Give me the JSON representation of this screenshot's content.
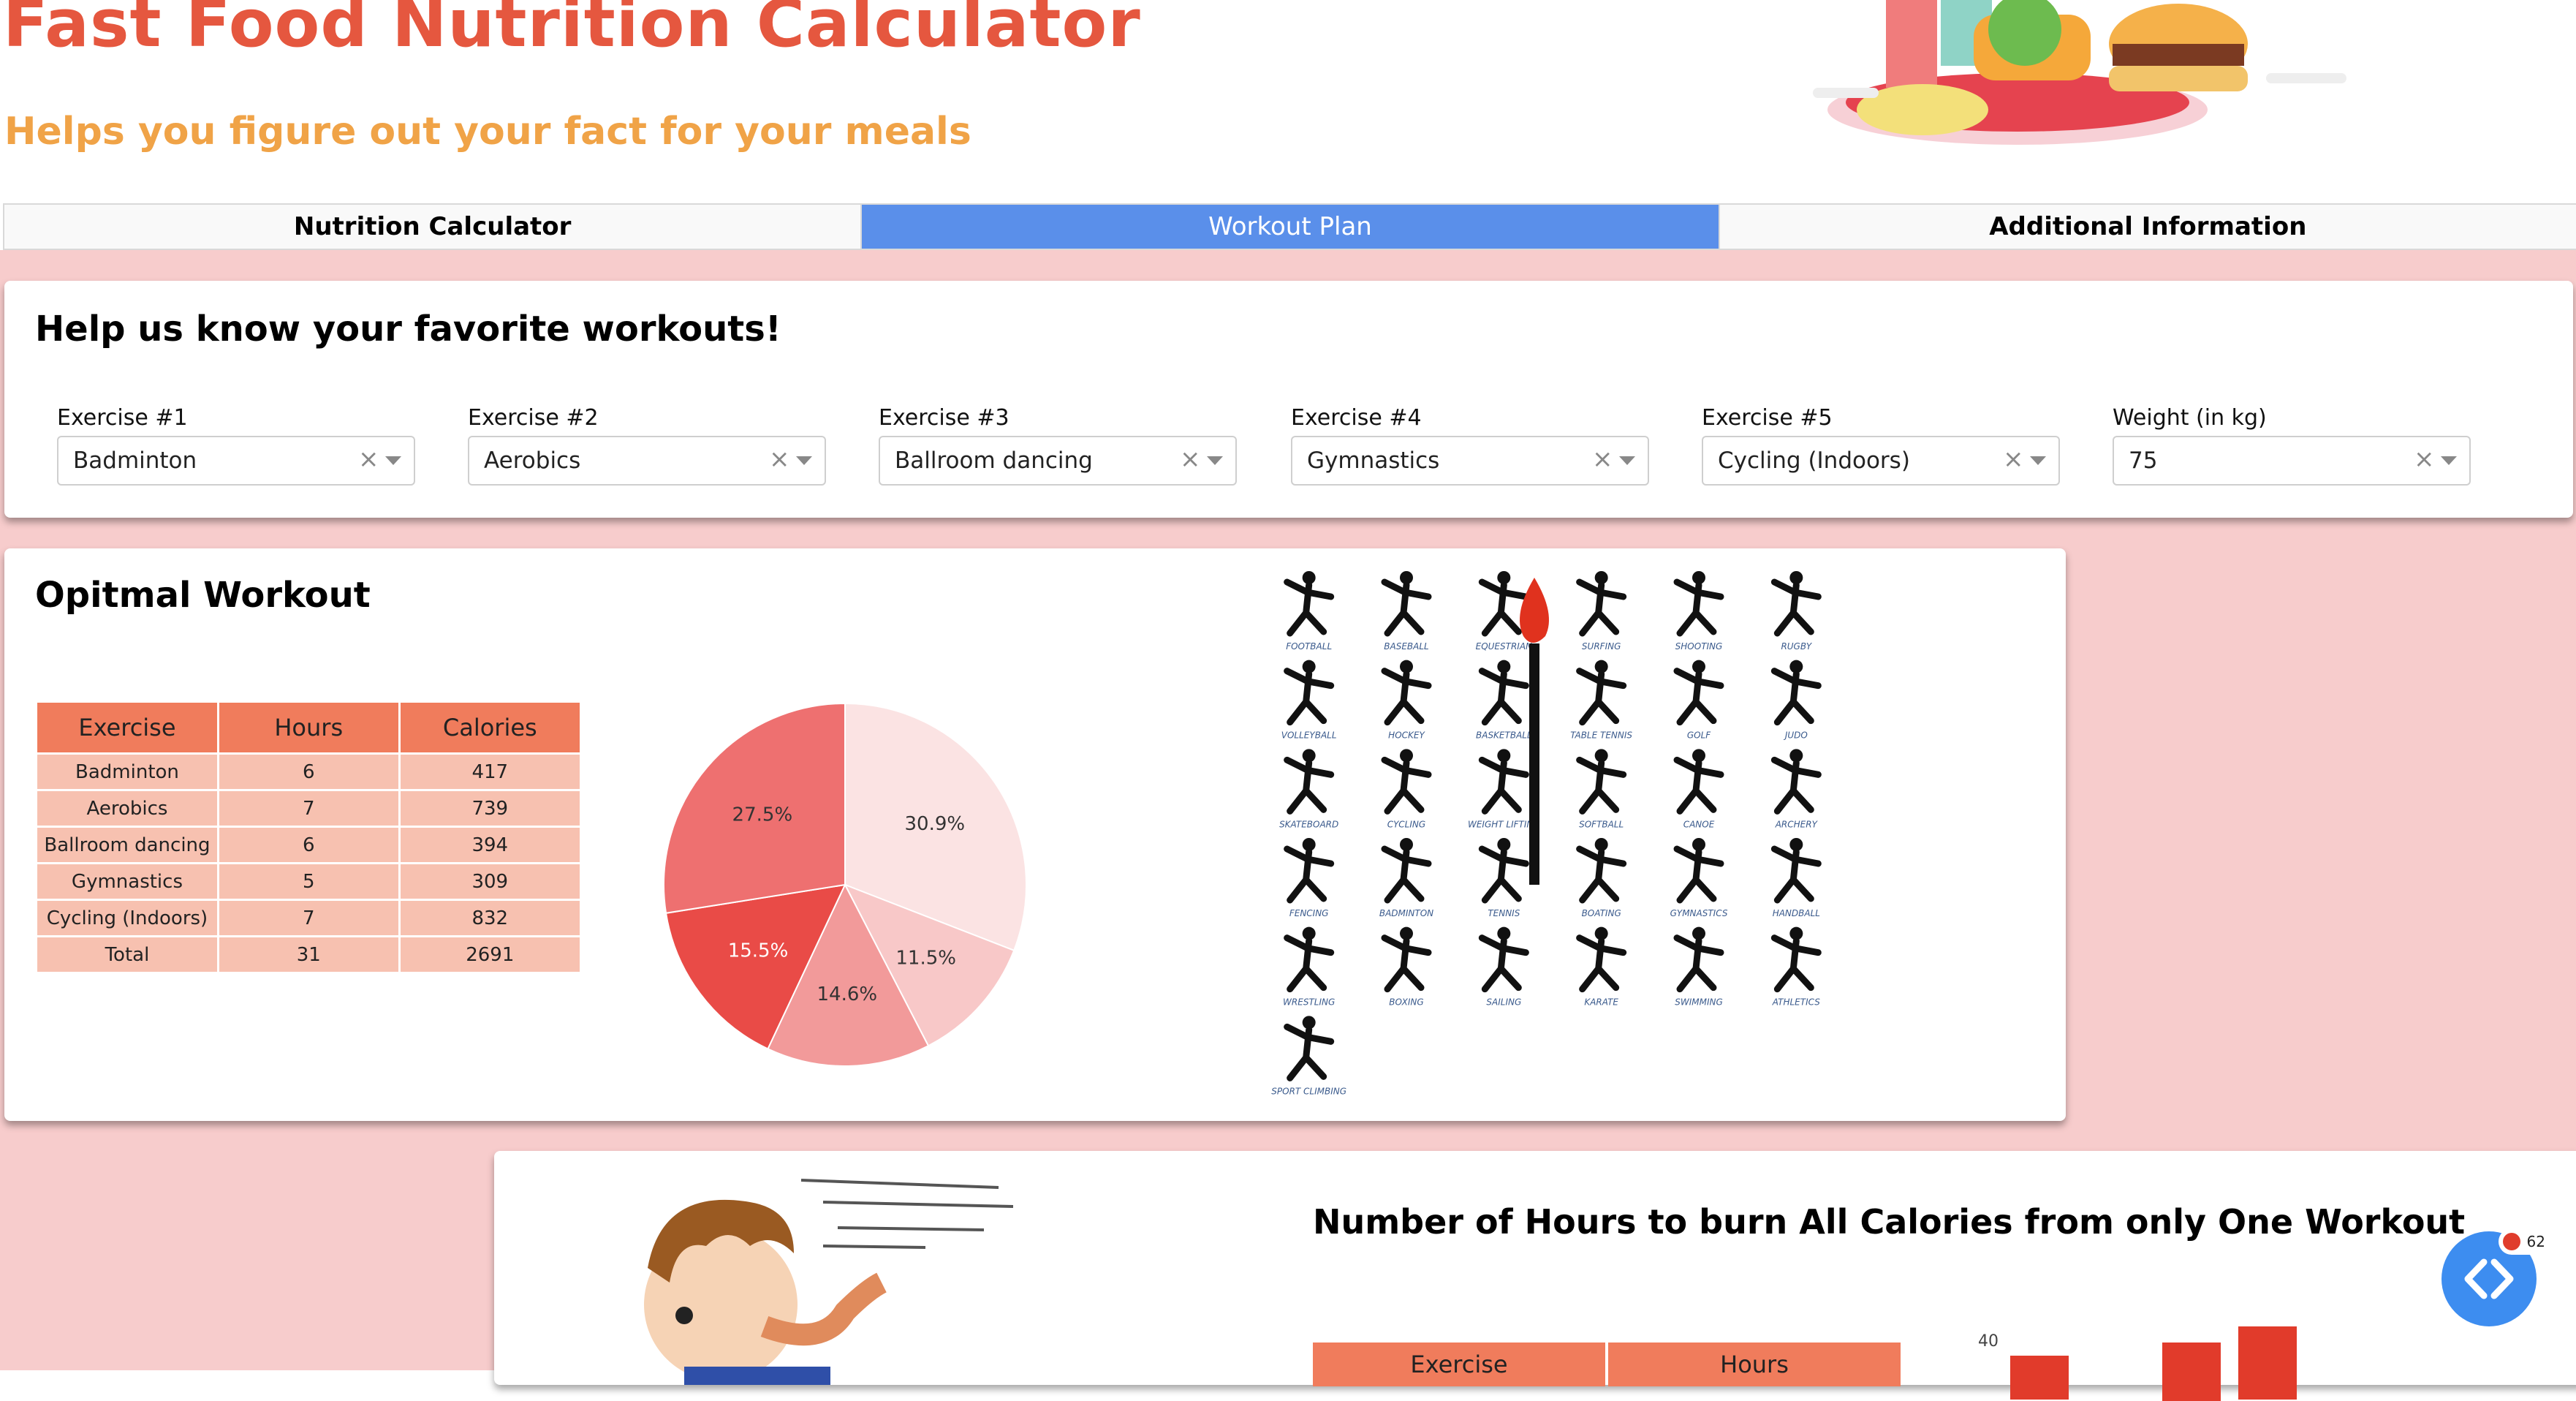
{
  "header": {
    "title": "Fast Food Nutrition Calculator",
    "subtitle": "Helps you figure out your fact for your meals"
  },
  "tabs": [
    {
      "label": "Nutrition Calculator",
      "active": false
    },
    {
      "label": "Workout Plan",
      "active": true
    },
    {
      "label": "Additional Information",
      "active": false
    }
  ],
  "workouts": {
    "title": "Help us know your favorite workouts!",
    "dropdowns": [
      {
        "label": "Exercise #1",
        "value": "Badminton"
      },
      {
        "label": "Exercise #2",
        "value": "Aerobics"
      },
      {
        "label": "Exercise #3",
        "value": "Ballroom dancing"
      },
      {
        "label": "Exercise #4",
        "value": "Gymnastics"
      },
      {
        "label": "Exercise #5",
        "value": "Cycling (Indoors)"
      },
      {
        "label": "Weight (in kg)",
        "value": "75"
      }
    ],
    "clear_glyph": "×"
  },
  "optimal": {
    "title": "Opitmal Workout",
    "table": {
      "headers": [
        "Exercise",
        "Hours",
        "Calories"
      ],
      "rows": [
        [
          "Badminton",
          "6",
          "417"
        ],
        [
          "Aerobics",
          "7",
          "739"
        ],
        [
          "Ballroom dancing",
          "6",
          "394"
        ],
        [
          "Gymnastics",
          "5",
          "309"
        ],
        [
          "Cycling (Indoors)",
          "7",
          "832"
        ],
        [
          "Total",
          "31",
          "2691"
        ]
      ]
    },
    "pie": {
      "slices": [
        {
          "label": "30.9%",
          "value": 30.9,
          "color": "#fbe3e3"
        },
        {
          "label": "11.5%",
          "value": 11.5,
          "color": "#f8c8c8"
        },
        {
          "label": "14.6%",
          "value": 14.6,
          "color": "#f29a9a"
        },
        {
          "label": "15.5%",
          "value": 15.5,
          "color": "#e94b47"
        },
        {
          "label": "27.5%",
          "value": 27.5,
          "color": "#ee7070"
        }
      ]
    },
    "sports_labels": [
      "FOOTBALL",
      "BASEBALL",
      "EQUESTRIAN",
      "SURFING",
      "SHOOTING",
      "RUGBY",
      "VOLLEYBALL",
      "HOCKEY",
      "BASKETBALL",
      "TABLE TENNIS",
      "GOLF",
      "JUDO",
      "SKATEBOARD",
      "CYCLING",
      "WEIGHT LIFTING",
      "SOFTBALL",
      "CANOE",
      "ARCHERY",
      "FENCING",
      "BADMINTON",
      "TENNIS",
      "BOATING",
      "GYMNASTICS",
      "HANDBALL",
      "WRESTLING",
      "BOXING",
      "SAILING",
      "KARATE",
      "SWIMMING",
      "ATHLETICS",
      "SPORT CLIMBING"
    ]
  },
  "hours": {
    "title": "Number of Hours to burn All Calories from only One Workout",
    "table_headers": [
      "Exercise",
      "Hours"
    ],
    "chart_tick": "40"
  },
  "fab": {
    "icon": "code-brackets-icon",
    "badge": "62"
  },
  "colors": {
    "accent_red": "#e5573f",
    "accent_orange": "#f0a347",
    "tab_active": "#5a8fea",
    "page_pink": "#f7cccc",
    "table_header": "#f07c5c",
    "table_cell": "#f7c1b0"
  }
}
